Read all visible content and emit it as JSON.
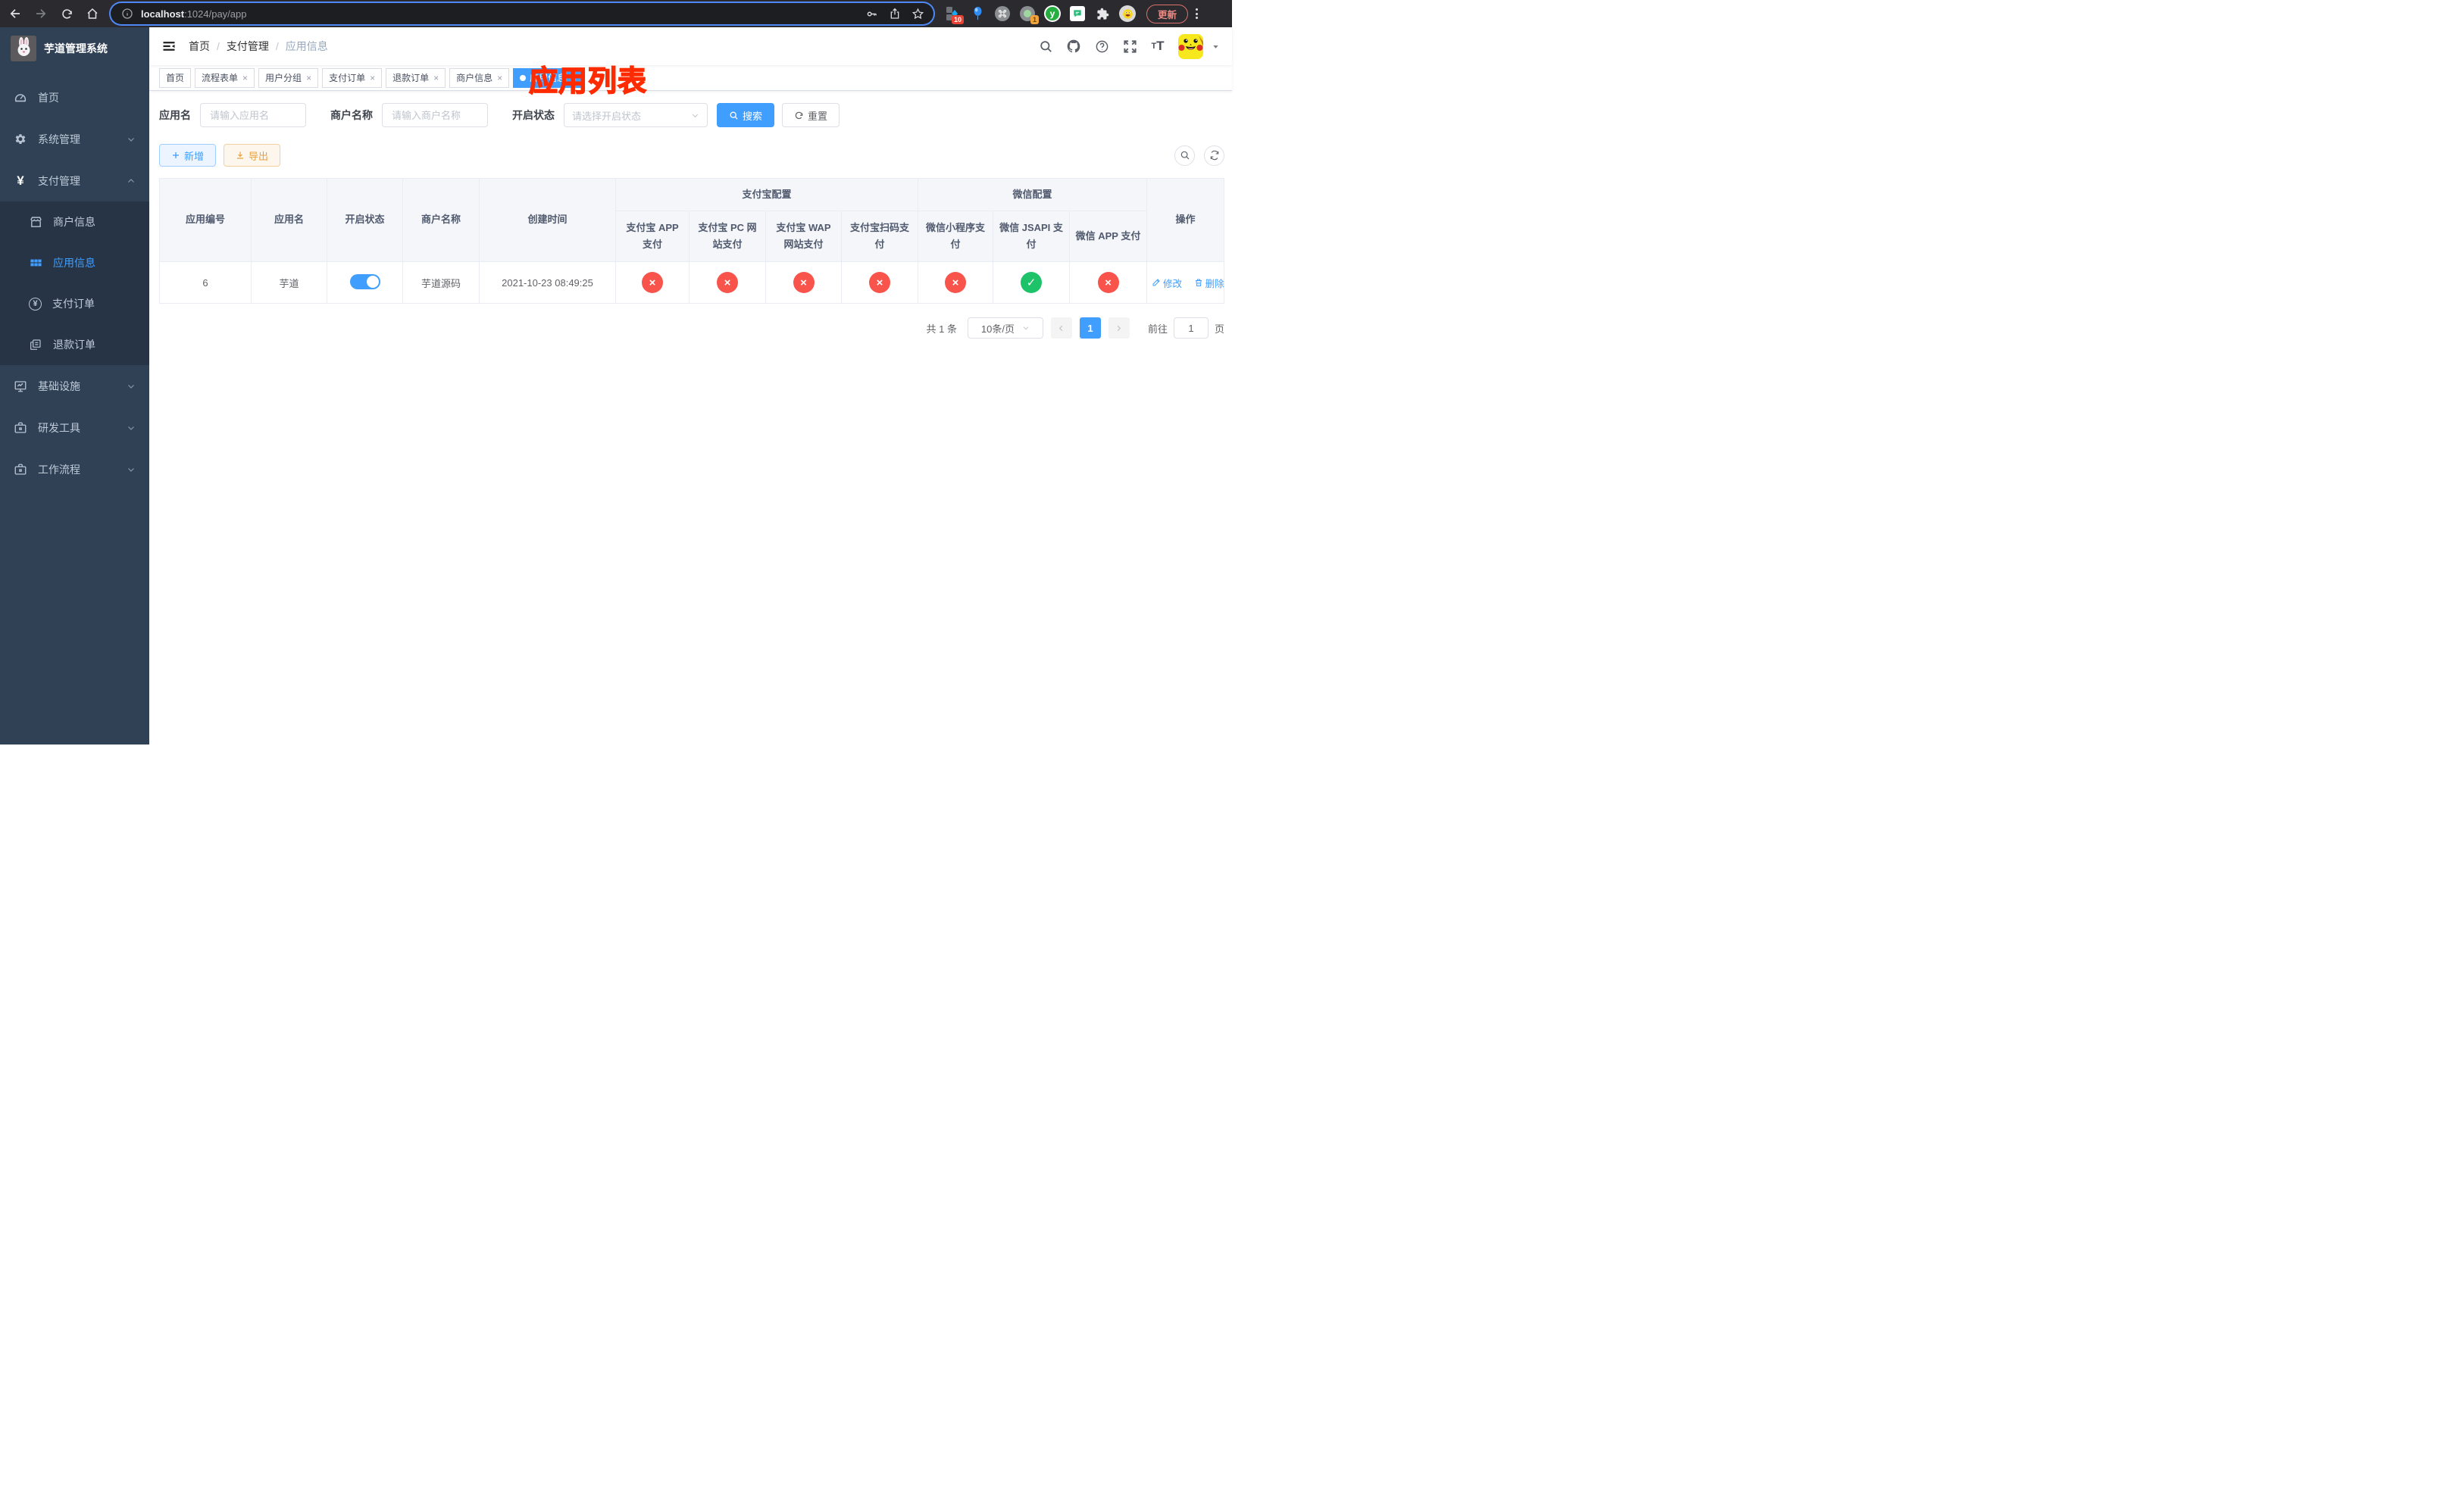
{
  "browser": {
    "url_host": "localhost",
    "url_rest": ":1024/pay/app",
    "update_label": "更新",
    "ext_badge_blue": "10",
    "ext_badge_record": "1",
    "ext_y_letter": "y"
  },
  "sidebar": {
    "title": "芋道管理系统",
    "items": [
      {
        "label": "首页"
      },
      {
        "label": "系统管理"
      },
      {
        "label": "支付管理"
      },
      {
        "label": "商户信息"
      },
      {
        "label": "应用信息"
      },
      {
        "label": "支付订单"
      },
      {
        "label": "退款订单"
      },
      {
        "label": "基础设施"
      },
      {
        "label": "研发工具"
      },
      {
        "label": "工作流程"
      }
    ]
  },
  "navbar": {
    "breadcrumb": {
      "home": "首页",
      "section": "支付管理",
      "current": "应用信息"
    }
  },
  "annotation": {
    "text": "应用列表"
  },
  "tabs": [
    {
      "label": "首页"
    },
    {
      "label": "流程表单"
    },
    {
      "label": "用户分组"
    },
    {
      "label": "支付订单"
    },
    {
      "label": "退款订单"
    },
    {
      "label": "商户信息"
    },
    {
      "label": "应用信息",
      "active": true
    }
  ],
  "filters": {
    "app_name_label": "应用名",
    "app_name_placeholder": "请输入应用名",
    "merchant_label": "商户名称",
    "merchant_placeholder": "请输入商户名称",
    "status_label": "开启状态",
    "status_placeholder": "请选择开启状态",
    "search_label": "搜索",
    "reset_label": "重置"
  },
  "toolbar": {
    "add_label": "新增",
    "export_label": "导出"
  },
  "table": {
    "columns": [
      "应用编号",
      "应用名",
      "开启状态",
      "商户名称",
      "创建时间"
    ],
    "group_alipay": "支付宝配置",
    "group_wechat": "微信配置",
    "pay_columns": [
      "支付宝 APP 支付",
      "支付宝 PC 网站支付",
      "支付宝 WAP 网站支付",
      "支付宝扫码支付",
      "微信小程序支付",
      "微信 JSAPI 支付",
      "微信 APP 支付"
    ],
    "actions_header": "操作",
    "row": {
      "id": "6",
      "name": "芋道",
      "enabled": true,
      "merchant": "芋道源码",
      "created_at": "2021-10-23 08:49:25",
      "configs": [
        "disabled",
        "disabled",
        "disabled",
        "disabled",
        "disabled",
        "enabled",
        "disabled"
      ],
      "edit_label": "修改",
      "delete_label": "删除"
    }
  },
  "pagination": {
    "total_text": "共 1 条",
    "page_size": "10条/页",
    "current_page": "1",
    "goto_label": "前往",
    "goto_value": "1",
    "page_suffix": "页"
  },
  "colors": {
    "primary": "#409eff",
    "danger_circle": "#f8544c",
    "success_circle": "#1ec269",
    "sidebar_bg": "#304156",
    "submenu_bg": "#263445",
    "annotation_red": "#ff2b00"
  }
}
